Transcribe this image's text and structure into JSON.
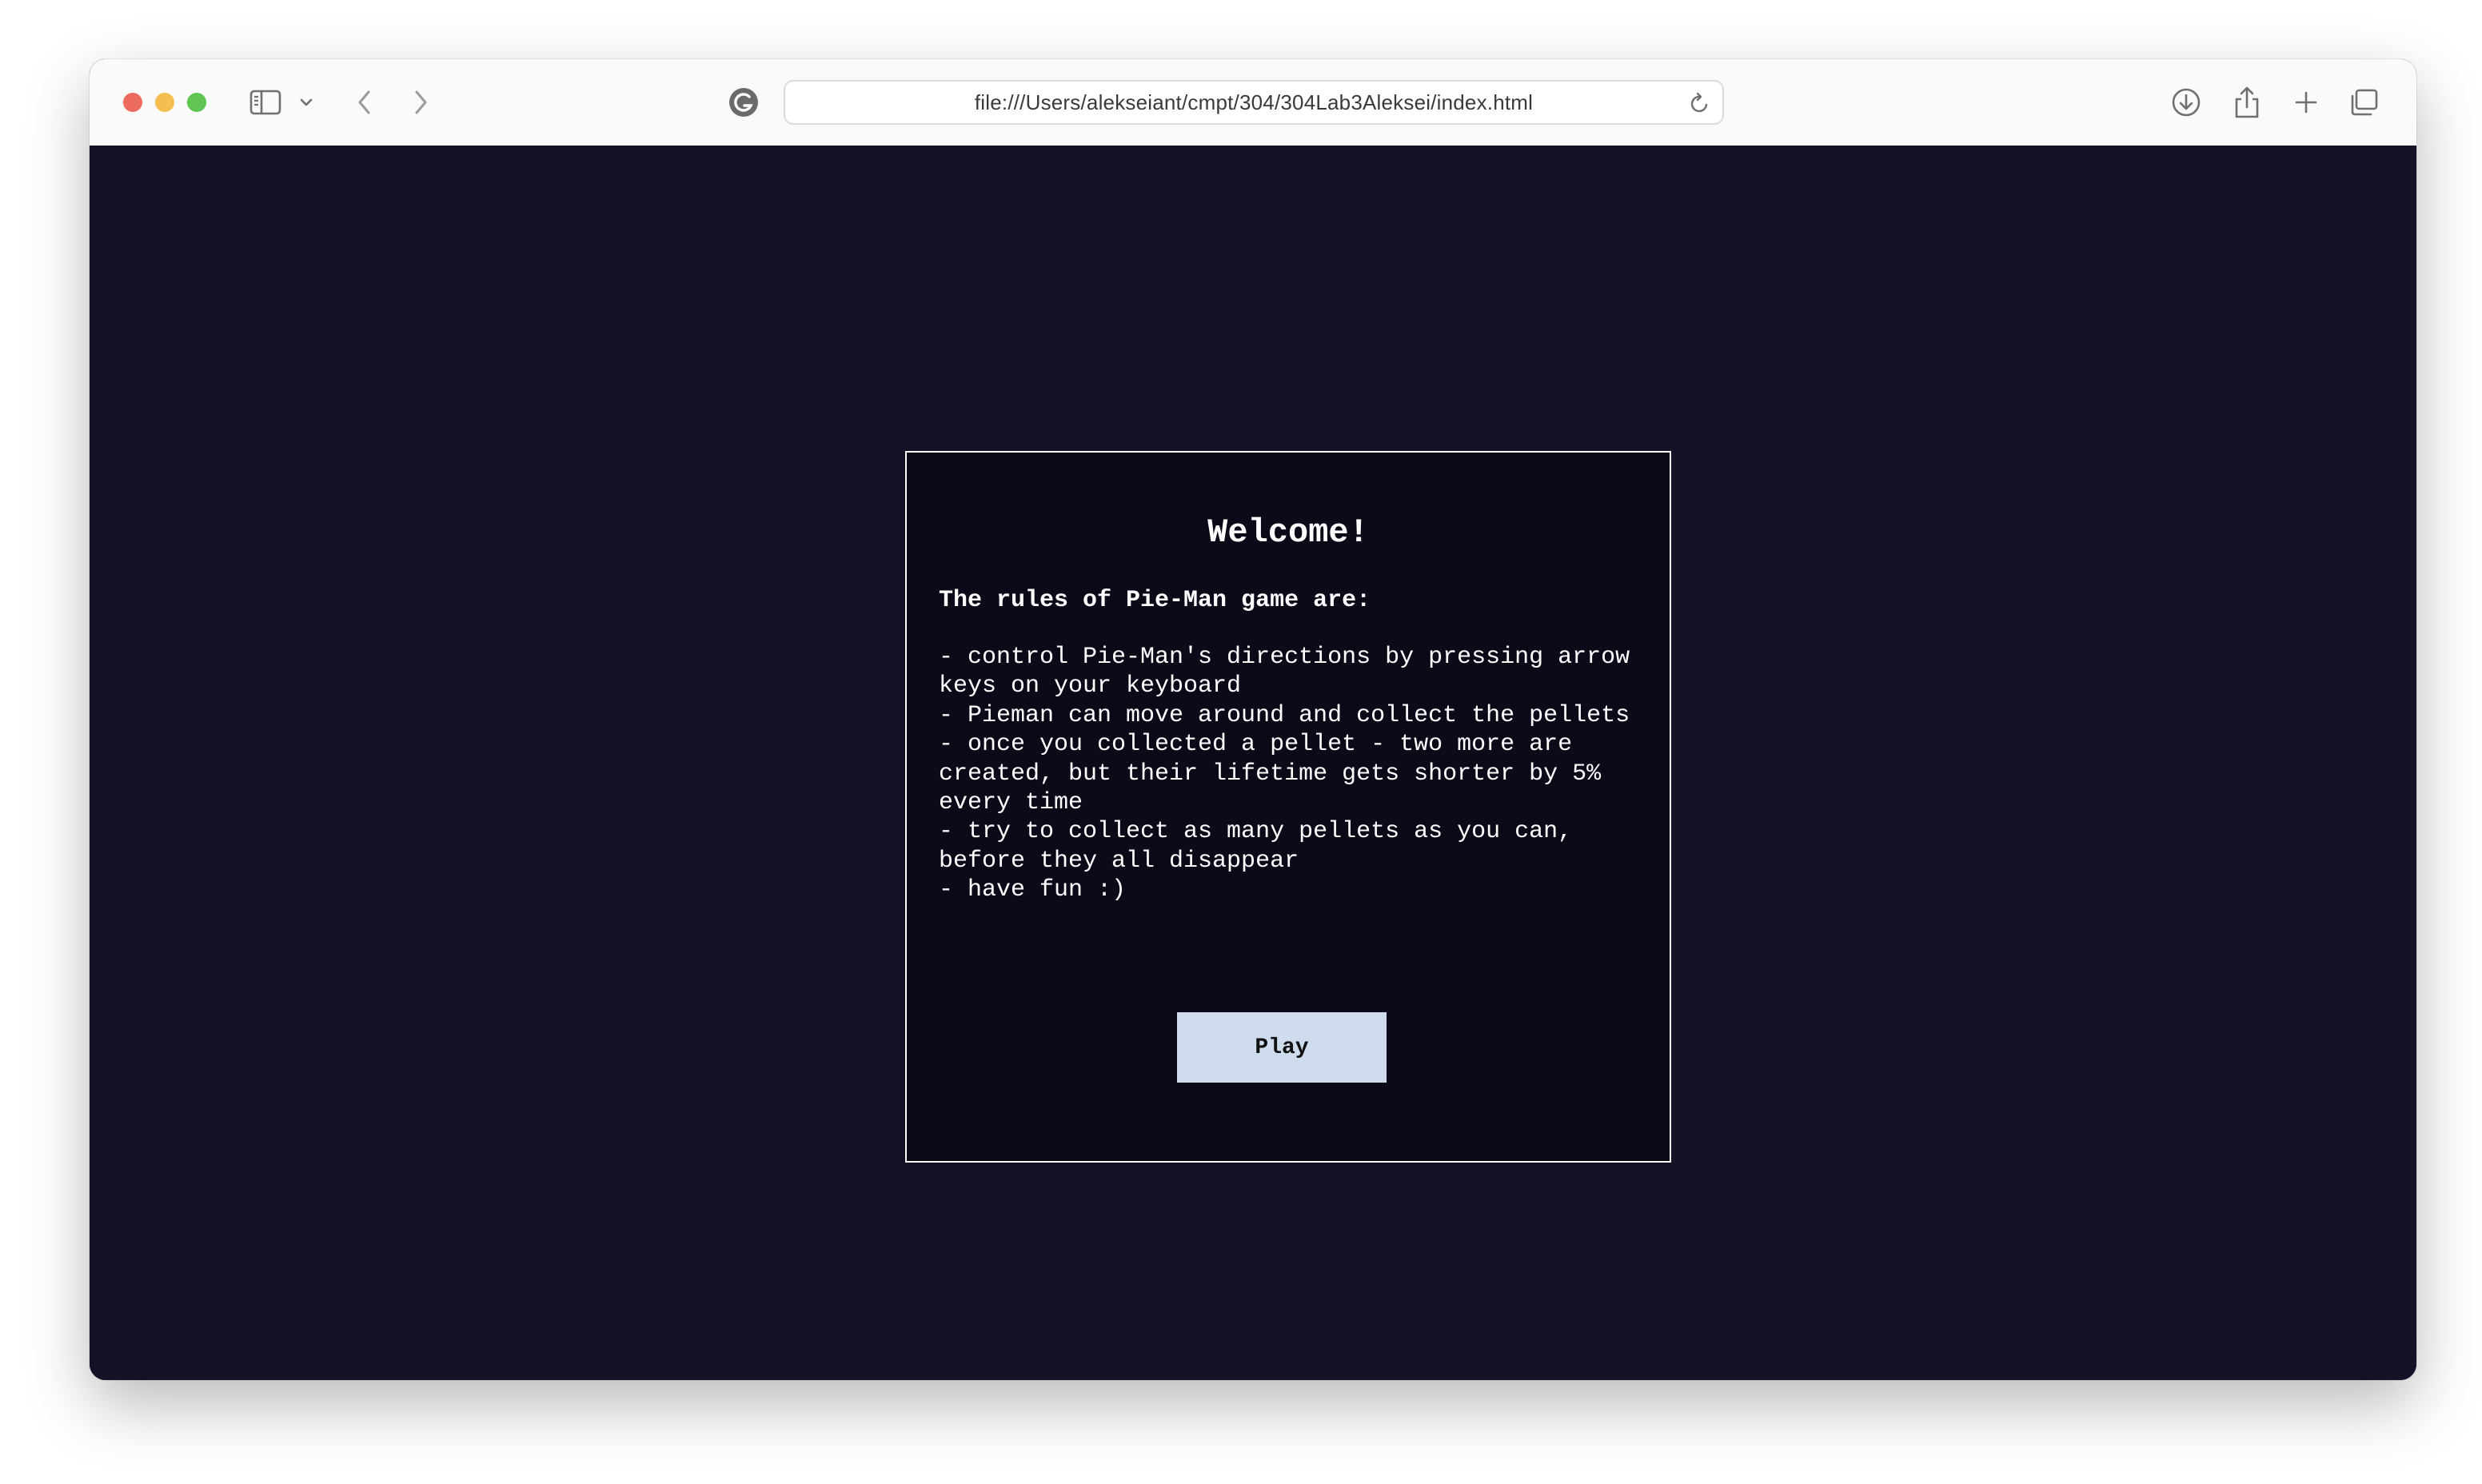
{
  "browser": {
    "url": "file:///Users/alekseiant/cmpt/304/304Lab3Aleksei/index.html"
  },
  "dialog": {
    "title": "Welcome!",
    "rules_heading": "The rules of Pie-Man game are:",
    "rules": [
      "- control Pie-Man's directions by pressing arrow keys on your keyboard",
      "- Pieman can move around and collect the pellets",
      "- once you collected a pellet - two more are created, but their lifetime gets shorter by 5% every time",
      "- try to collect as many pellets as you can, before they all disappear",
      "- have fun :)"
    ],
    "play_label": "Play"
  },
  "colors": {
    "page_background": "#141226",
    "dialog_background": "#0b0a18",
    "dialog_border": "#ffffff",
    "button_background": "#cfdcee"
  },
  "icons": {
    "sidebar": "sidebar-icon",
    "chevron": "chevron-down-icon",
    "back": "back-arrow-icon",
    "forward": "forward-arrow-icon",
    "extension": "grammarly-icon",
    "reload": "reload-icon",
    "downloads": "download-icon",
    "share": "share-icon",
    "new_tab": "plus-icon",
    "tabs": "tab-overview-icon"
  }
}
